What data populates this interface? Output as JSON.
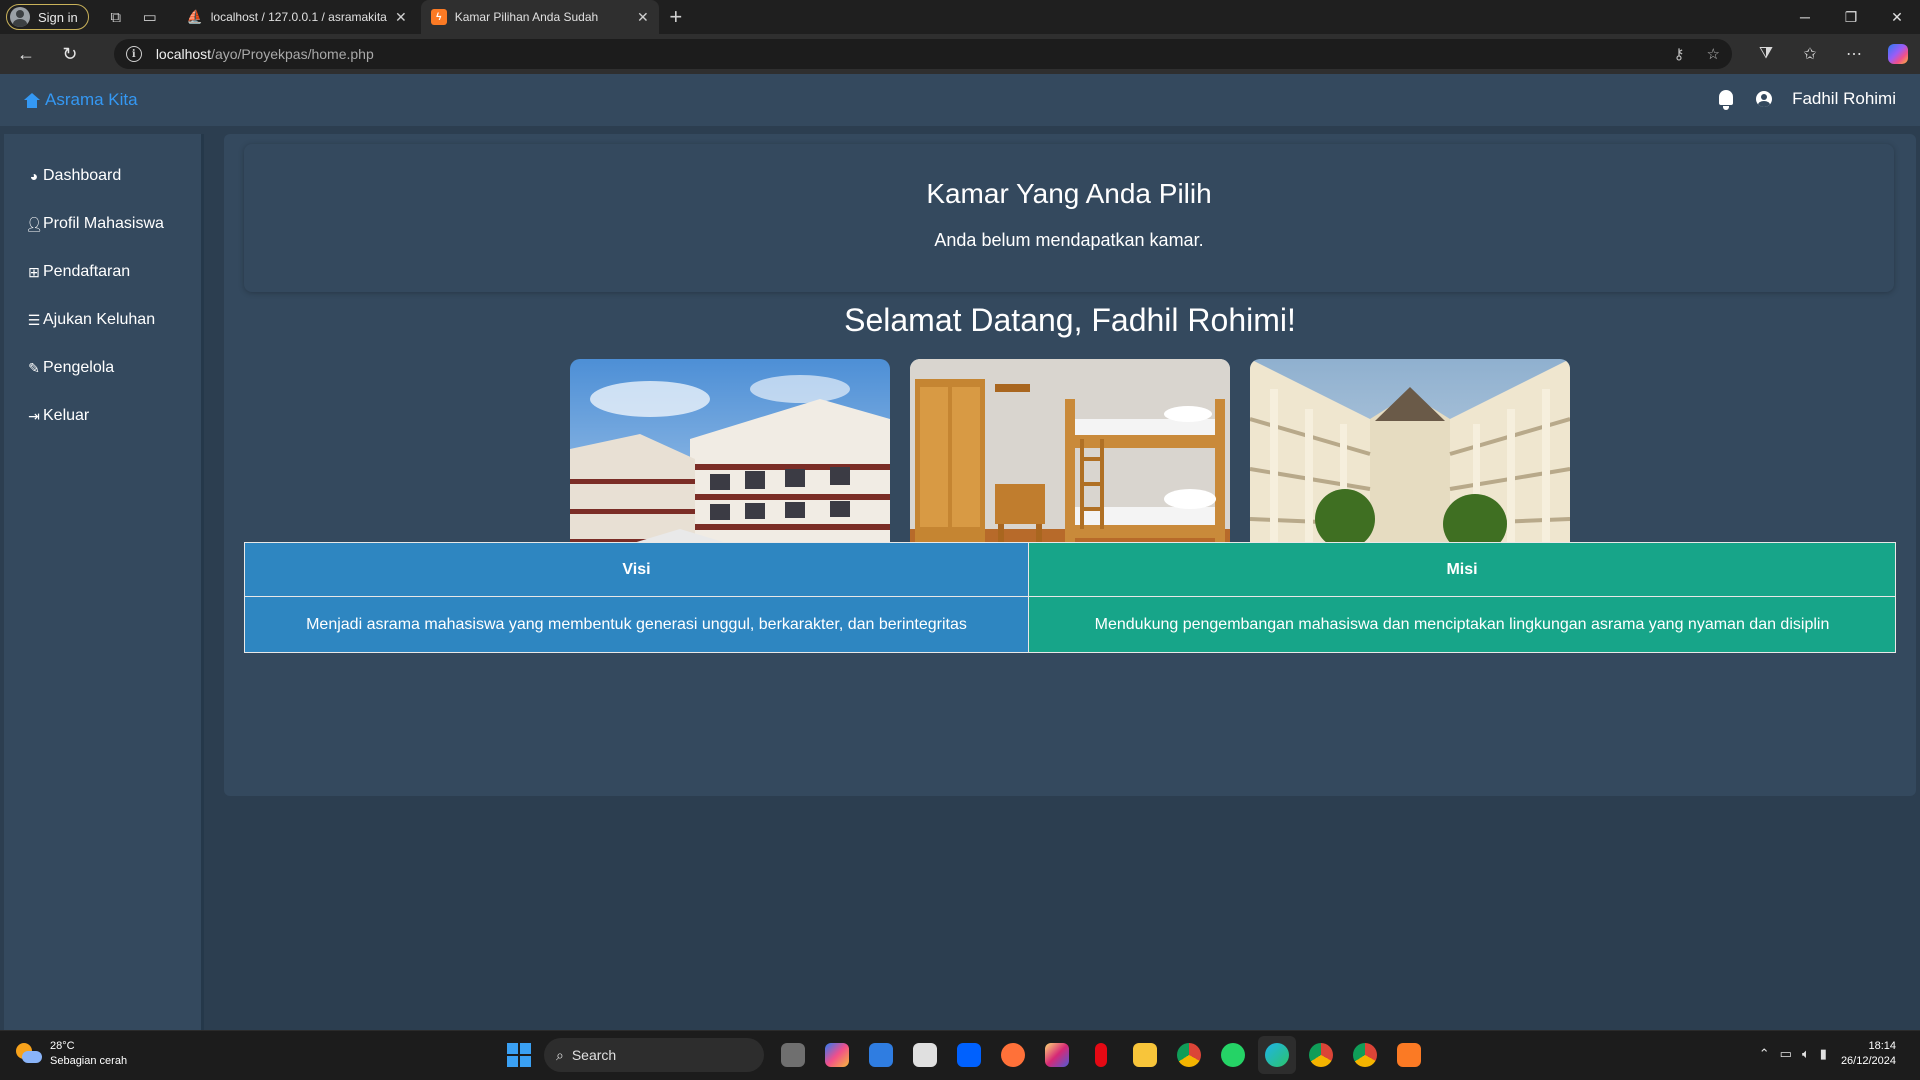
{
  "browser": {
    "signin_label": "Sign in",
    "tabs": [
      {
        "title": "localhost / 127.0.0.1 / asramakita",
        "active": false
      },
      {
        "title": "Kamar Pilihan Anda Sudah",
        "active": true
      }
    ],
    "url_host": "localhost",
    "url_path": "/ayo/Proyekpas/home.php"
  },
  "app": {
    "brand": "Asrama Kita",
    "user_name": "Fadhil Rohimi"
  },
  "sidebar": {
    "items": [
      {
        "label": "Dashboard",
        "icon": "dashboard-icon"
      },
      {
        "label": "Profil Mahasiswa",
        "icon": "user-icon"
      },
      {
        "label": "Pendaftaran",
        "icon": "table-icon"
      },
      {
        "label": "Ajukan Keluhan",
        "icon": "list-icon"
      },
      {
        "label": "Pengelola",
        "icon": "pencil-icon"
      },
      {
        "label": "Keluar",
        "icon": "sign-out-icon"
      }
    ]
  },
  "main": {
    "room_card": {
      "title": "Kamar Yang Anda Pilih",
      "message": "Anda belum mendapatkan kamar."
    },
    "welcome": "Selamat Datang, Fadhil Rohimi!",
    "photos": [
      "dormitory-building-photo",
      "bunk-bed-room-photo",
      "dormitory-courtyard-photo"
    ],
    "vision_mission": {
      "headers": [
        "Visi",
        "Misi"
      ],
      "row": [
        "Menjadi asrama mahasiswa yang membentuk generasi unggul, berkarakter, dan berintegritas",
        "Mendukung pengembangan mahasiswa dan menciptakan lingkungan asrama yang nyaman dan disiplin"
      ]
    }
  },
  "taskbar": {
    "weather_temp": "28°C",
    "weather_desc": "Sebagian cerah",
    "search_label": "Search",
    "time": "18:14",
    "date": "26/12/2024"
  },
  "colors": {
    "page_bg": "#2c3e50",
    "panel_bg": "#34495e",
    "brand": "#3498f3",
    "visi": "#2e86c1",
    "misi": "#17a589"
  }
}
